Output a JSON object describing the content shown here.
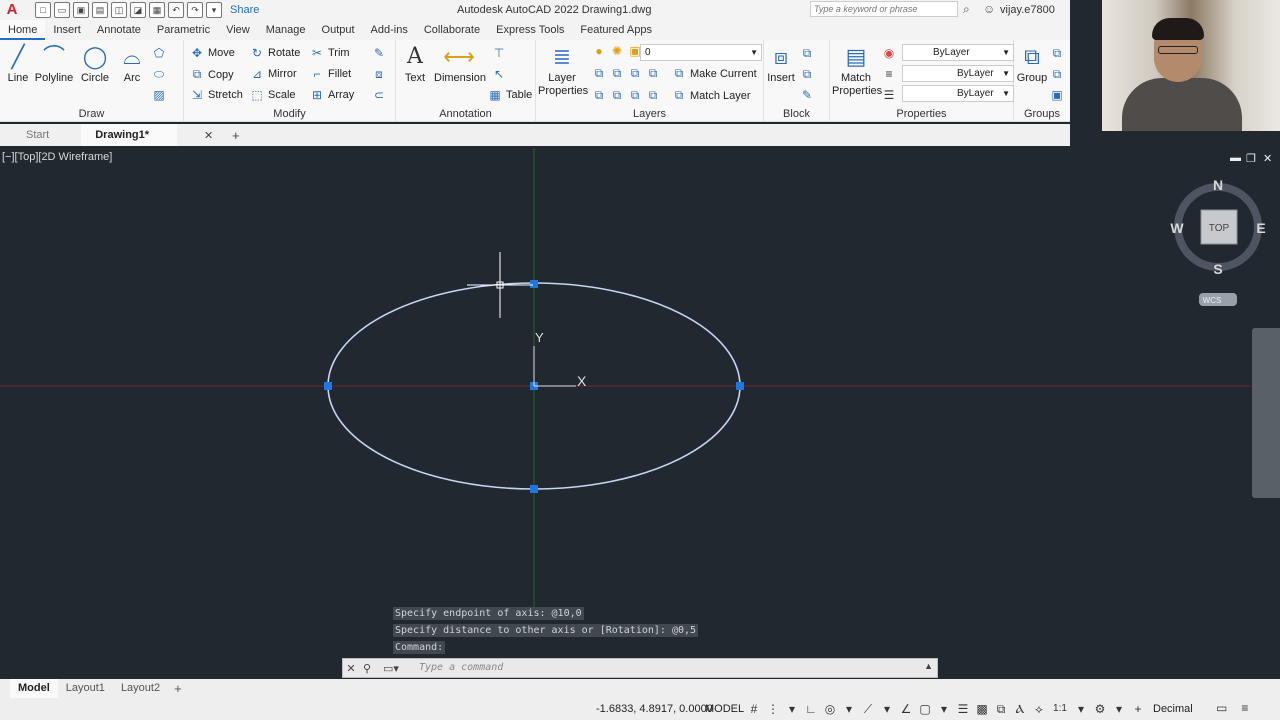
{
  "titlebar": {
    "app_logo": "A",
    "share_label": "Share",
    "title": "Autodesk AutoCAD 2022    Drawing1.dwg",
    "search_placeholder": "Type a keyword or phrase",
    "user": "vijay.e7800"
  },
  "tabs": [
    "Home",
    "Insert",
    "Annotate",
    "Parametric",
    "View",
    "Manage",
    "Output",
    "Add-ins",
    "Collaborate",
    "Express Tools",
    "Featured Apps"
  ],
  "ribbon": {
    "draw": {
      "title": "Draw",
      "line": "Line",
      "polyline": "Polyline",
      "circle": "Circle",
      "arc": "Arc"
    },
    "modify": {
      "title": "Modify",
      "move": "Move",
      "rotate": "Rotate",
      "trim": "Trim",
      "copy": "Copy",
      "mirror": "Mirror",
      "fillet": "Fillet",
      "stretch": "Stretch",
      "scale": "Scale",
      "array": "Array"
    },
    "annotation": {
      "title": "Annotation",
      "text": "Text",
      "dimension": "Dimension",
      "table": "Table"
    },
    "layers": {
      "title": "Layers",
      "layer_properties": "Layer Properties",
      "current_layer": "0",
      "make_current": "Make Current",
      "match_layer": "Match Layer"
    },
    "block": {
      "title": "Block",
      "insert": "Insert"
    },
    "properties": {
      "title": "Properties",
      "match_properties": "Match Properties",
      "color": "ByLayer",
      "linetype": "ByLayer",
      "lineweight": "ByLayer"
    },
    "groups": {
      "title": "Groups",
      "group": "Group"
    }
  },
  "filetabs": {
    "start": "Start",
    "active": "Drawing1*"
  },
  "viewport": {
    "label": "[−][Top][2D Wireframe]",
    "viewcube": {
      "n": "N",
      "s": "S",
      "e": "E",
      "w": "W",
      "face": "TOP",
      "ucs": "WCS"
    },
    "ucs_x": "X",
    "ucs_y": "Y"
  },
  "command": {
    "history": [
      "Specify endpoint of axis: @10,0",
      "Specify distance to other axis or [Rotation]: @0,5",
      "Command:"
    ],
    "placeholder": "Type a command"
  },
  "layouts": [
    "Model",
    "Layout1",
    "Layout2"
  ],
  "statusbar": {
    "coords": "-1.6833, 4.8917, 0.0000",
    "model": "MODEL",
    "scale": "1:1",
    "units": "Decimal"
  },
  "colors": {
    "canvas": "#212830",
    "ellipse": "#c5d6f2",
    "grip": "#1f78e0",
    "x_axis": "#7a2d33",
    "y_axis": "#2c6a34"
  }
}
